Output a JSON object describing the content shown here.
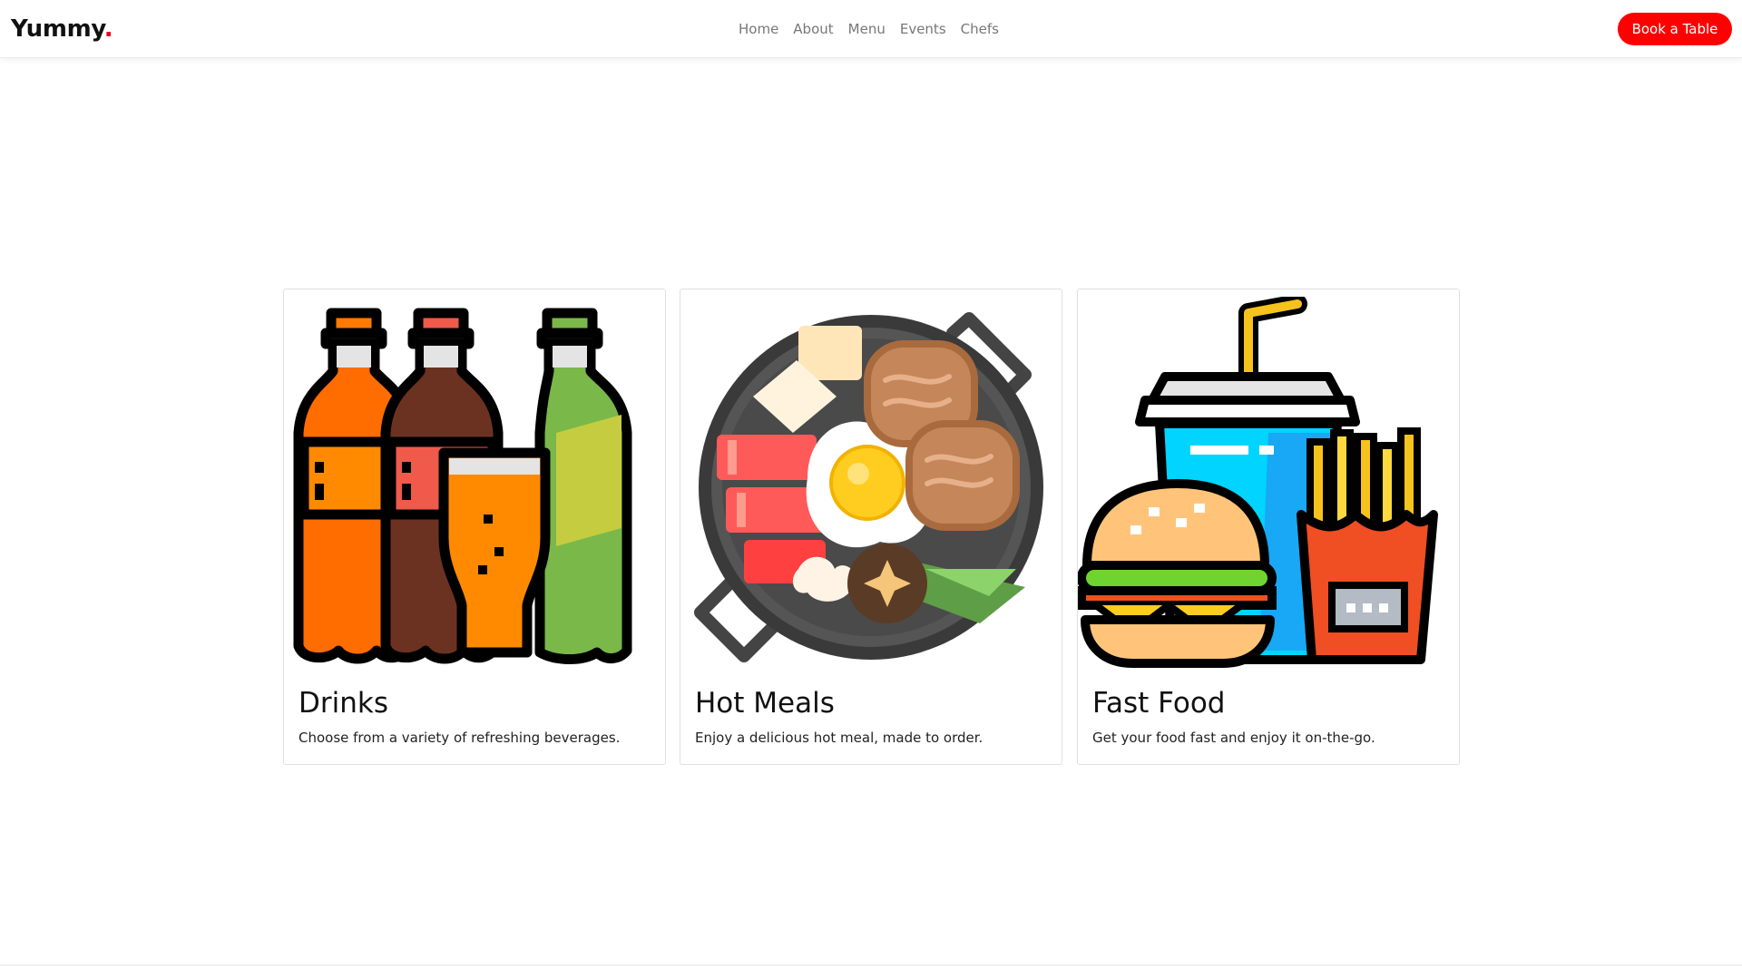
{
  "brand": {
    "name": "Yummy",
    "dot": "."
  },
  "nav": {
    "items": [
      "Home",
      "About",
      "Menu",
      "Events",
      "Chefs"
    ]
  },
  "header": {
    "cta_label": "Book a Table"
  },
  "cards": [
    {
      "title": "Drinks",
      "text": "Choose from a variety of refreshing beverages.",
      "icon": "soda-bottles-icon"
    },
    {
      "title": "Hot Meals",
      "text": "Enjoy a delicious hot meal, made to order.",
      "icon": "frying-pan-meal-icon"
    },
    {
      "title": "Fast Food",
      "text": "Get your food fast and enjoy it on-the-go.",
      "icon": "burger-fries-drink-icon"
    }
  ],
  "colors": {
    "accent": "#ff0000",
    "nav_text": "#777777",
    "text": "#111111"
  }
}
